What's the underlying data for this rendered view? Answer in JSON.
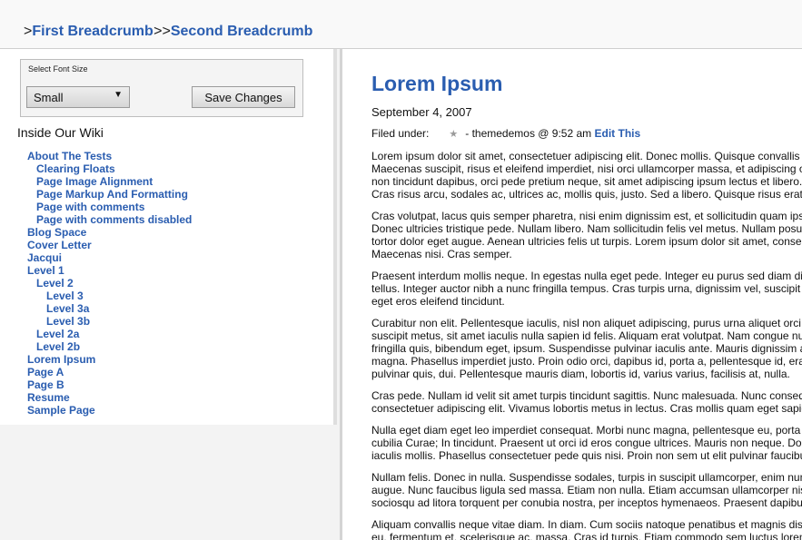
{
  "breadcrumb": {
    "prefix": ">",
    "first": "First Breadcrumb",
    "separator": ">>",
    "second": "Second Breadcrumb"
  },
  "sidebar": {
    "font_size_label": "Select Font Size",
    "font_size_value": "Small",
    "save_label": "Save Changes",
    "wiki_title": "Inside Our Wiki",
    "nav": [
      {
        "label": "About The Tests",
        "level": 0
      },
      {
        "label": "Clearing Floats",
        "level": 1
      },
      {
        "label": "Page Image Alignment",
        "level": 1
      },
      {
        "label": "Page Markup And Formatting",
        "level": 1
      },
      {
        "label": "Page with comments",
        "level": 1
      },
      {
        "label": "Page with comments disabled",
        "level": 1
      },
      {
        "label": "Blog Space",
        "level": 0
      },
      {
        "label": "Cover Letter",
        "level": 0
      },
      {
        "label": "Jacqui",
        "level": 0
      },
      {
        "label": "Level 1",
        "level": 0
      },
      {
        "label": "Level 2",
        "level": 1
      },
      {
        "label": "Level 3",
        "level": 2
      },
      {
        "label": "Level 3a",
        "level": 2
      },
      {
        "label": "Level 3b",
        "level": 2
      },
      {
        "label": "Level 2a",
        "level": 1
      },
      {
        "label": "Level 2b",
        "level": 1
      },
      {
        "label": "Lorem Ipsum",
        "level": 0
      },
      {
        "label": "Page A",
        "level": 0
      },
      {
        "label": "Page B",
        "level": 0
      },
      {
        "label": "Resume",
        "level": 0
      },
      {
        "label": "Sample Page",
        "level": 0
      }
    ]
  },
  "post": {
    "title": "Lorem Ipsum",
    "date": "September 4, 2007",
    "filed_under": "Filed under:",
    "author_line": "- themedemos @ 9:52 am",
    "edit_link": "Edit This",
    "paragraphs": [
      [
        "Lorem ipsum dolor sit amet, consectetuer adipiscing elit. Donec mollis. Quisque convallis libero in sapien pharetra tincidunt.",
        "Maecenas suscipit, risus et eleifend imperdiet, nisi orci ullamcorper massa, et adipiscing orci velit quis magna.",
        "non tincidunt dapibus, orci pede pretium neque, sit amet adipiscing ipsum lectus et libero. Aenean bibendum.",
        "Cras risus arcu, sodales ac, ultrices ac, mollis quis, justo. Sed a libero. Quisque risus erat, posuere at."
      ],
      [
        "Cras volutpat, lacus quis semper pharetra, nisi enim dignissim est, et sollicitudin quam ipsum vel mi. Sed commodo.",
        "Donec ultricies tristique pede. Nullam libero. Nam sollicitudin felis vel metus. Nullam posuere molestie metus.",
        "tortor dolor eget augue. Aenean ultricies felis ut turpis. Lorem ipsum dolor sit amet, consectetuer adipiscing elit.",
        "Maecenas nisi. Cras semper."
      ],
      [
        "Praesent interdum mollis neque. In egestas nulla eget pede. Integer eu purus sed diam dictum scelerisque.",
        "tellus. Integer auctor nibh a nunc fringilla tempus. Cras turpis urna, dignissim vel, suscipit pulvinar, rutrum quis,",
        "eget eros eleifend tincidunt."
      ],
      [
        "Curabitur non elit. Pellentesque iaculis, nisl non aliquet adipiscing, purus urna aliquet orci, sed sodales pede neque at massa.",
        "suscipit metus, sit amet iaculis nulla sapien id felis. Aliquam erat volutpat. Nam congue nulla a ligula.",
        "fringilla quis, bibendum eget, ipsum. Suspendisse pulvinar iaculis ante. Mauris dignissim ante quis nisi.",
        "magna. Phasellus imperdiet justo. Proin odio orci, dapibus id, porta a, pellentesque id, erat. Quisque mollis.",
        "pulvinar quis, dui. Pellentesque mauris diam, lobortis id, varius varius, facilisis at, nulla."
      ],
      [
        "Cras pede. Nullam id velit sit amet turpis tincidunt sagittis. Nunc malesuada. Nunc consequat scelerisque odio.",
        "consectetuer adipiscing elit. Vivamus lobortis metus in lectus. Cras mollis quam eget sapien."
      ],
      [
        "Nulla eget diam eget leo imperdiet consequat. Morbi nunc magna, pellentesque eu, porta at, ultricies ut, neque.",
        "cubilia Curae; In tincidunt. Praesent ut orci id eros congue ultrices. Mauris non neque. Donec nulla ante, molestie sit amet,",
        "iaculis mollis. Phasellus consectetuer pede quis nisi. Proin non sem ut elit pulvinar faucibus."
      ],
      [
        "Nullam felis. Donec in nulla. Suspendisse sodales, turpis in suscipit ullamcorper, enim nunc sagittis risus, eu auctor velit tortor ut turpis.",
        "augue. Nunc faucibus ligula sed massa. Etiam non nulla. Etiam accumsan ullamcorper nisl. Class aptent taciti",
        "sociosqu ad litora torquent per conubia nostra, per inceptos hymenaeos. Praesent dapibus."
      ],
      [
        "Aliquam convallis neque vitae diam. In diam. Cum sociis natoque penatibus et magnis dis parturient montes,",
        "eu, fermentum et, scelerisque ac, massa. Cras id turpis. Etiam commodo sem luctus lorem."
      ]
    ]
  }
}
